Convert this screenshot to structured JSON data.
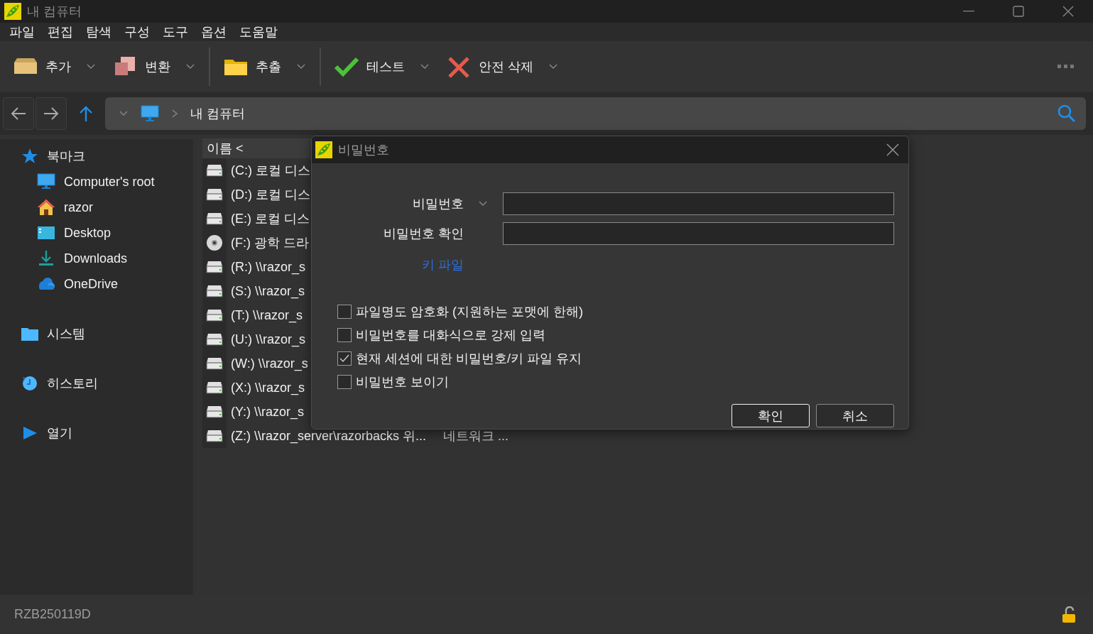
{
  "window": {
    "title": "내 컴퓨터"
  },
  "menu": [
    "파일",
    "편집",
    "탐색",
    "구성",
    "도구",
    "옵션",
    "도움말"
  ],
  "toolbar": [
    {
      "label": "추가"
    },
    {
      "label": "변환"
    },
    {
      "label": "추출"
    },
    {
      "label": "테스트"
    },
    {
      "label": "안전 삭제"
    }
  ],
  "address": {
    "path": "내 컴퓨터"
  },
  "sidebar": [
    {
      "label": "북마크",
      "children": [
        {
          "label": "Computer's root"
        },
        {
          "label": "razor"
        },
        {
          "label": "Desktop"
        },
        {
          "label": "Downloads"
        },
        {
          "label": "OneDrive"
        }
      ]
    },
    {
      "label": "시스템"
    },
    {
      "label": "히스토리"
    },
    {
      "label": "열기"
    }
  ],
  "file_list": {
    "column_1": "이름 <",
    "rows": [
      {
        "name": "(C:) 로컬 디스",
        "kind": "drive"
      },
      {
        "name": "(D:) 로컬 디스",
        "kind": "drive"
      },
      {
        "name": "(E:) 로컬 디스",
        "kind": "drive"
      },
      {
        "name": "(F:) 광학 드라",
        "kind": "disc"
      },
      {
        "name": "(R:) \\\\razor_s",
        "kind": "drive"
      },
      {
        "name": "(S:) \\\\razor_s",
        "kind": "drive"
      },
      {
        "name": "(T:) \\\\razor_s",
        "kind": "drive"
      },
      {
        "name": "(U:) \\\\razor_s",
        "kind": "drive"
      },
      {
        "name": "(W:) \\\\razor_s",
        "kind": "drive"
      },
      {
        "name": "(X:) \\\\razor_s",
        "kind": "drive"
      },
      {
        "name": "(Y:) \\\\razor_s",
        "kind": "drive"
      },
      {
        "name": "(Z:) \\\\razor_server\\razorbacks 위...",
        "kind": "drive",
        "column_2": "네트워크 ..."
      }
    ]
  },
  "dialog": {
    "title": "비밀번호",
    "fields": [
      {
        "label": "비밀번호",
        "dropdown": true
      },
      {
        "label": "비밀번호 확인",
        "dropdown": false
      }
    ],
    "link": "키 파일",
    "options": [
      {
        "label": "파일명도 암호화 (지원하는 포맷에 한해)",
        "checked": false
      },
      {
        "label": "비밀번호를 대화식으로 강제 입력",
        "checked": false
      },
      {
        "label": "현재 세션에 대한 비밀번호/키 파일 유지",
        "checked": true
      },
      {
        "label": "비밀번호 보이기",
        "checked": false
      }
    ],
    "buttons": [
      {
        "label": "확인",
        "default": true
      },
      {
        "label": "취소",
        "default": false
      }
    ]
  },
  "status_bar": {
    "text": "RZB250119D"
  }
}
